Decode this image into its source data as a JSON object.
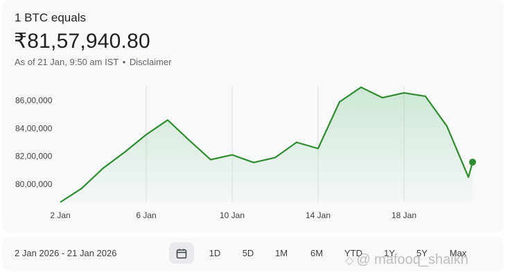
{
  "header": {
    "title": "1 BTC equals",
    "price": "₹81,57,940.80",
    "as_of": "As of 21 Jan, 9:50 am IST",
    "separator": "•",
    "disclaimer": "Disclaimer"
  },
  "footer": {
    "date_range": "2 Jan 2026 - 21 Jan 2026",
    "periods": [
      "1D",
      "5D",
      "1M",
      "6M",
      "YTD",
      "1Y",
      "5Y",
      "Max"
    ]
  },
  "watermark": {
    "text": "@ mafooq_shaikh",
    "icon": "diamond-logo-icon"
  },
  "colors": {
    "line": "#2e8b2e",
    "accent": "#2e8b2e",
    "grid": "#e0e0e0"
  },
  "chart_data": {
    "type": "area",
    "x": [
      "2 Jan",
      "3 Jan",
      "4 Jan",
      "5 Jan",
      "6 Jan",
      "7 Jan",
      "8 Jan",
      "9 Jan",
      "10 Jan",
      "11 Jan",
      "12 Jan",
      "13 Jan",
      "14 Jan",
      "15 Jan",
      "16 Jan",
      "17 Jan",
      "18 Jan",
      "19 Jan",
      "20 Jan",
      "21 Jan"
    ],
    "x_ticks": [
      "2 Jan",
      "6 Jan",
      "10 Jan",
      "14 Jan",
      "18 Jan"
    ],
    "series": [
      {
        "values": [
          7870000,
          7970000,
          8115000,
          8230000,
          8355000,
          8460000,
          8315000,
          8175000,
          8210000,
          8155000,
          8190000,
          8300000,
          8255000,
          8590000,
          8695000,
          8620000,
          8655000,
          8630000,
          8415000,
          8050000
        ]
      }
    ],
    "last_point": {
      "x": "21 Jan",
      "y": 8157940.8
    },
    "y_ticks": [
      "80,00,000",
      "82,00,000",
      "84,00,000",
      "86,00,000"
    ],
    "y_tick_values": [
      8000000,
      8200000,
      8400000,
      8600000
    ],
    "ylim": [
      7870000,
      8700000
    ],
    "grid": "vertical",
    "legend": "none"
  }
}
